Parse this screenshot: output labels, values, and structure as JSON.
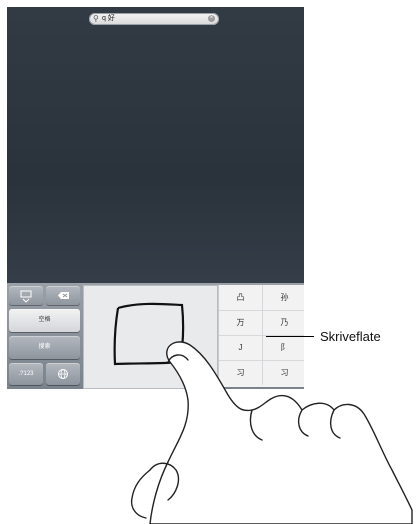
{
  "search": {
    "query": "q 好",
    "magnifier_icon": "magnifier-icon",
    "clear_icon": "clear-icon"
  },
  "keyboard": {
    "hide_keyboard_icon": "keyboard-hide-icon",
    "delete_icon": "delete-icon",
    "key_space": "空格",
    "key_search": "搜索",
    "key_switch": ".?123",
    "globe_icon": "globe-icon",
    "candidates": [
      "凸",
      "孙",
      "万",
      "乃",
      "J",
      "阝",
      "习",
      "习"
    ]
  },
  "callout": {
    "label": "Skriveflate"
  }
}
